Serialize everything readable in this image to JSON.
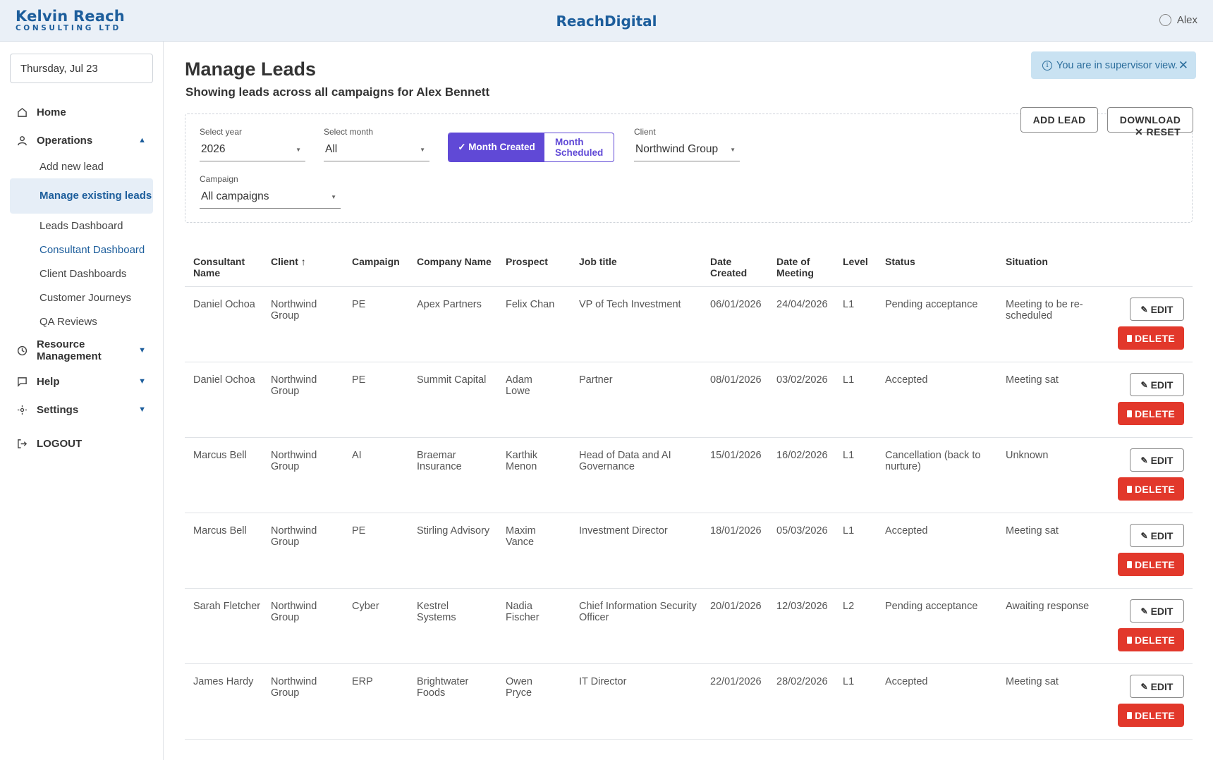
{
  "header": {
    "logo_main": "Kelvin Reach",
    "logo_sub": "CONSULTING LTD",
    "brand": "ReachDigital",
    "user_name": "Alex"
  },
  "sidebar": {
    "date": "Thursday, Jul 23",
    "home": "Home",
    "operations": "Operations",
    "operations_items": [
      "Add new lead",
      "Manage existing leads",
      "Leads Dashboard",
      "Consultant Dashboard",
      "Client Dashboards",
      "Customer Journeys",
      "QA Reviews"
    ],
    "resource_management": "Resource Management",
    "help": "Help",
    "settings": "Settings",
    "logout": "LOGOUT"
  },
  "page": {
    "title": "Manage Leads",
    "subtitle": "Showing leads across all campaigns for Alex Bennett",
    "alert": "You are in supervisor view."
  },
  "filters": {
    "year_label": "Select year",
    "year_value": "2026",
    "month_label": "Select month",
    "month_value": "All",
    "toggle_on": "✓ Month Created",
    "toggle_off": "Month Scheduled",
    "client_label": "Client",
    "client_value": "Northwind Group",
    "campaign_label": "Campaign",
    "campaign_value": "All campaigns",
    "add_lead": "ADD LEAD",
    "download": "DOWNLOAD",
    "reset": "RESET"
  },
  "table": {
    "columns": [
      "Consultant Name",
      "Client ↑",
      "Campaign",
      "Company Name",
      "Prospect",
      "Job title",
      "Date Created",
      "Date of Meeting",
      "Level",
      "Status",
      "Situation"
    ],
    "edit_label": "EDIT",
    "delete_label": "DELETE",
    "rows": [
      [
        "Daniel Ochoa",
        "Northwind Group",
        "PE",
        "Apex Partners",
        "Felix Chan",
        "VP of Tech Investment",
        "06/01/2026",
        "24/04/2026",
        "L1",
        "Pending acceptance",
        "Meeting to be re-scheduled"
      ],
      [
        "Daniel Ochoa",
        "Northwind Group",
        "PE",
        "Summit Capital",
        "Adam Lowe",
        "Partner",
        "08/01/2026",
        "03/02/2026",
        "L1",
        "Accepted",
        "Meeting sat"
      ],
      [
        "Marcus Bell",
        "Northwind Group",
        "AI",
        "Braemar Insurance",
        "Karthik Menon",
        "Head of Data and AI Governance",
        "15/01/2026",
        "16/02/2026",
        "L1",
        "Cancellation (back to nurture)",
        "Unknown"
      ],
      [
        "Marcus Bell",
        "Northwind Group",
        "PE",
        "Stirling Advisory",
        "Maxim Vance",
        "Investment Director",
        "18/01/2026",
        "05/03/2026",
        "L1",
        "Accepted",
        "Meeting sat"
      ],
      [
        "Sarah Fletcher",
        "Northwind Group",
        "Cyber",
        "Kestrel Systems",
        "Nadia Fischer",
        "Chief Information Security Officer",
        "20/01/2026",
        "12/03/2026",
        "L2",
        "Pending acceptance",
        "Awaiting response"
      ],
      [
        "James Hardy",
        "Northwind Group",
        "ERP",
        "Brightwater Foods",
        "Owen Pryce",
        "IT Director",
        "22/01/2026",
        "28/02/2026",
        "L1",
        "Accepted",
        "Meeting sat"
      ]
    ]
  }
}
